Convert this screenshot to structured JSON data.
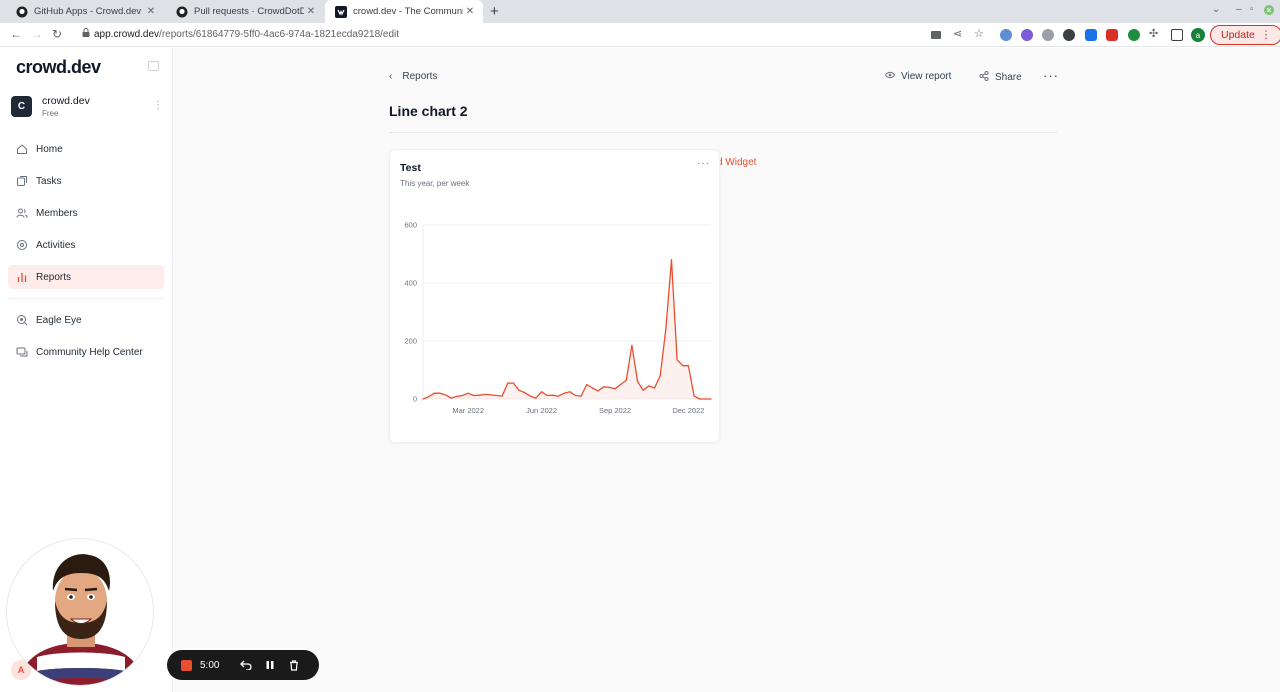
{
  "browser": {
    "tabs": [
      {
        "title": "GitHub Apps - Crowd.dev GitHub",
        "icon": "github-icon"
      },
      {
        "title": "Pull requests · CrowdDotDev/crowd.dev",
        "icon": "github-icon"
      },
      {
        "title": "crowd.dev - The Community-led",
        "icon": "crowd-icon",
        "active": true
      }
    ],
    "url_host": "app.crowd.dev",
    "url_path": "/reports/61864779-5ff0-4ac6-974a-1821ecda9218/edit",
    "update_label": "Update",
    "profile_initial": "a"
  },
  "sidebar": {
    "logo": "crowd.dev",
    "workspace": {
      "initial": "C",
      "name": "crowd.dev",
      "plan": "Free"
    },
    "nav": [
      {
        "label": "Home",
        "icon": "home-icon"
      },
      {
        "label": "Tasks",
        "icon": "tasks-icon"
      },
      {
        "label": "Members",
        "icon": "members-icon"
      },
      {
        "label": "Activities",
        "icon": "activities-icon"
      },
      {
        "label": "Reports",
        "icon": "reports-icon",
        "active": true
      }
    ],
    "secondary_nav": [
      {
        "label": "Eagle Eye",
        "icon": "eagle-eye-icon"
      },
      {
        "label": "Community Help Center",
        "icon": "help-center-icon"
      }
    ],
    "user_initial": "A"
  },
  "recorder": {
    "time": "5:00"
  },
  "header": {
    "back_label": "Reports",
    "view_report_label": "View report",
    "share_label": "Share",
    "title": "Line chart 2",
    "add_widget_label": "d Widget"
  },
  "widget": {
    "title": "Test",
    "subtitle": "This year, per week"
  },
  "chart_data": {
    "type": "area",
    "title": "Test",
    "subtitle": "This year, per week",
    "xlabel": "",
    "ylabel": "",
    "ylim": [
      0,
      600
    ],
    "yticks": [
      "0",
      "200",
      "400",
      "600"
    ],
    "xticks": [
      {
        "label": "Mar 2022",
        "index": 8
      },
      {
        "label": "Jun 2022",
        "index": 21
      },
      {
        "label": "Sep 2022",
        "index": 34
      },
      {
        "label": "Dec 2022",
        "index": 47
      }
    ],
    "grid": true,
    "color": "#e94f2e",
    "values": [
      0,
      8,
      20,
      20,
      14,
      3,
      9,
      12,
      20,
      12,
      13,
      16,
      14,
      12,
      10,
      55,
      55,
      30,
      22,
      10,
      3,
      25,
      12,
      13,
      10,
      20,
      25,
      12,
      10,
      50,
      38,
      28,
      42,
      40,
      35,
      50,
      65,
      185,
      60,
      30,
      45,
      38,
      80,
      240,
      480,
      135,
      115,
      115,
      10,
      0,
      0,
      0
    ]
  }
}
